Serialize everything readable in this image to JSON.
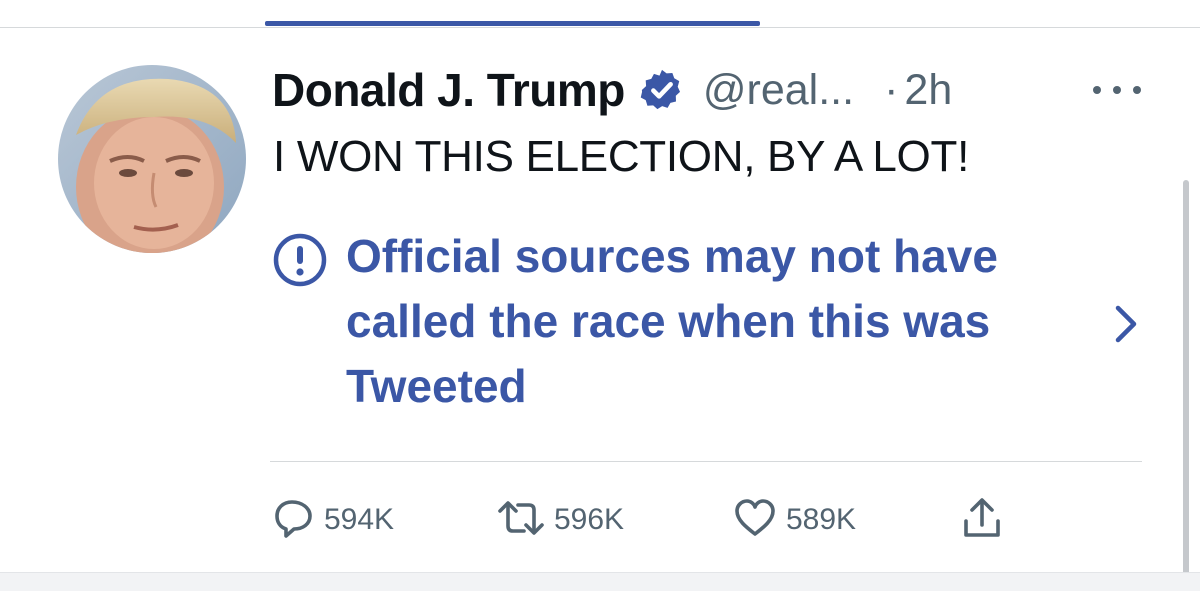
{
  "tweet": {
    "author_name": "Donald J. Trump",
    "handle": "@real...",
    "separator": "·",
    "time": "2h",
    "text": "I WON THIS ELECTION, BY A LOT!"
  },
  "notice": {
    "text": "Official sources may not have called the race when this was Tweeted"
  },
  "actions": {
    "replies": "594K",
    "retweets": "596K",
    "likes": "589K"
  },
  "icons": {
    "verified": "verified-badge-icon",
    "more": "more-options-icon",
    "notice": "exclamation-circle-icon",
    "chevron": "chevron-right-icon",
    "reply": "reply-icon",
    "retweet": "retweet-icon",
    "like": "heart-icon",
    "share": "share-icon"
  },
  "colors": {
    "accent": "#3b57a6",
    "muted": "#536471",
    "text": "#0f1419"
  }
}
